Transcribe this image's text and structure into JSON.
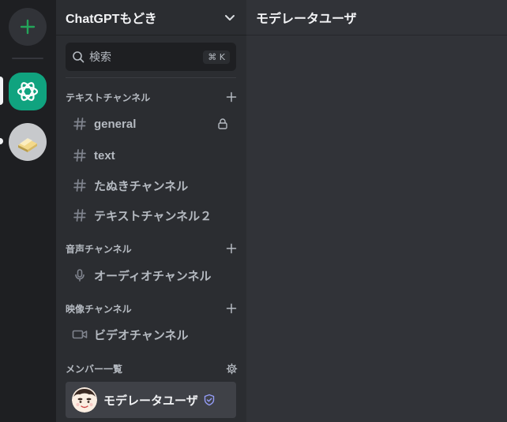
{
  "colors": {
    "rail_bg": "#1e1f22",
    "sidebar_bg": "#2b2d31",
    "main_bg": "#313338",
    "add_accent": "#23a55a",
    "gpt_green": "#10a37f",
    "badge_purple": "#949cf7"
  },
  "servers": [
    {
      "name": "ChatGPTもどき",
      "icon": "openai-logo-icon",
      "active": true
    },
    {
      "name": "",
      "icon": "tanuki-server-icon",
      "unread": true
    }
  ],
  "guild": {
    "name": "ChatGPTもどき",
    "menu_icon": "chevron-down-icon"
  },
  "search": {
    "label": "検索",
    "shortcut": "⌘ K"
  },
  "categories": {
    "text": {
      "label": "テキストチャンネル",
      "channels": [
        {
          "label": "general",
          "icon": "hash-icon",
          "locked": true
        },
        {
          "label": "text",
          "icon": "hash-icon"
        },
        {
          "label": "たぬきチャンネル",
          "icon": "hash-icon"
        },
        {
          "label": "テキストチャンネル２",
          "icon": "hash-icon"
        }
      ]
    },
    "voice": {
      "label": "音声チャンネル",
      "channels": [
        {
          "label": "オーディオチャンネル",
          "icon": "microphone-icon"
        }
      ]
    },
    "video": {
      "label": "映像チャンネル",
      "channels": [
        {
          "label": "ビデオチャンネル",
          "icon": "video-camera-icon"
        }
      ]
    },
    "members": {
      "label": "メンバー一覧",
      "items": [
        {
          "name": "モデレータユーザ",
          "badge": "shield-check-icon"
        }
      ]
    }
  },
  "main": {
    "title": "モデレータユーザ"
  }
}
